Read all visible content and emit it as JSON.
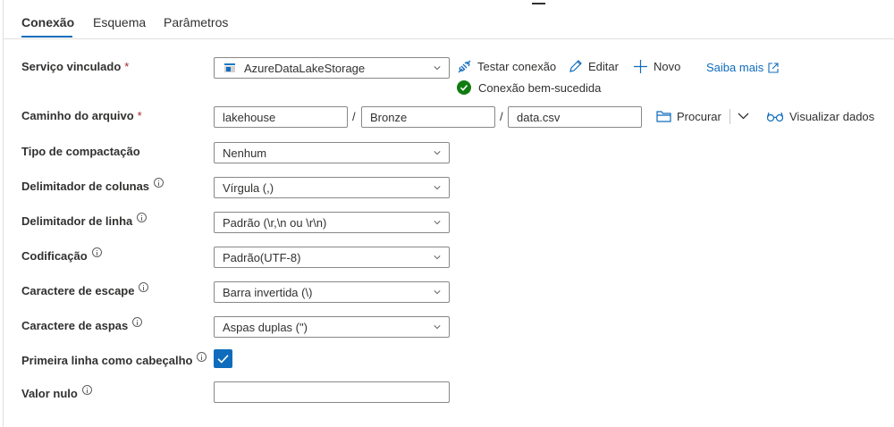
{
  "tabs": [
    {
      "label": "Conexão",
      "active": true
    },
    {
      "label": "Esquema",
      "active": false
    },
    {
      "label": "Parâmetros",
      "active": false
    }
  ],
  "linked_service": {
    "label": "Serviço vinculado",
    "required_mark": "*",
    "value": "AzureDataLakeStorage",
    "icon": "storage-icon"
  },
  "actions": {
    "test_connection": "Testar conexão",
    "edit": "Editar",
    "new": "Novo",
    "learn_more": "Saiba mais",
    "browse": "Procurar",
    "preview_data": "Visualizar dados"
  },
  "connection_status": "Conexão bem-sucedida",
  "file_path": {
    "label": "Caminho do arquivo",
    "required_mark": "*",
    "container": "lakehouse",
    "directory": "Bronze",
    "file": "data.csv",
    "separator": "/"
  },
  "fields": {
    "compression": {
      "label": "Tipo de compactação",
      "value": "Nenhum"
    },
    "column_delimiter": {
      "label": "Delimitador de colunas",
      "value": "Vírgula (,)"
    },
    "row_delimiter": {
      "label": "Delimitador de linha",
      "value": "Padrão (\\r,\\n ou \\r\\n)"
    },
    "encoding": {
      "label": "Codificação",
      "value": "Padrão(UTF-8)"
    },
    "escape_char": {
      "label": "Caractere de escape",
      "value": "Barra invertida (\\)"
    },
    "quote_char": {
      "label": "Caractere de aspas",
      "value": "Aspas duplas (\")"
    },
    "first_row_header": {
      "label": "Primeira linha como cabeçalho",
      "checked": true
    },
    "null_value": {
      "label": "Valor nulo",
      "value": ""
    }
  },
  "colors": {
    "accent": "#0f6cbd",
    "success": "#107c10",
    "required": "#a4262c"
  }
}
